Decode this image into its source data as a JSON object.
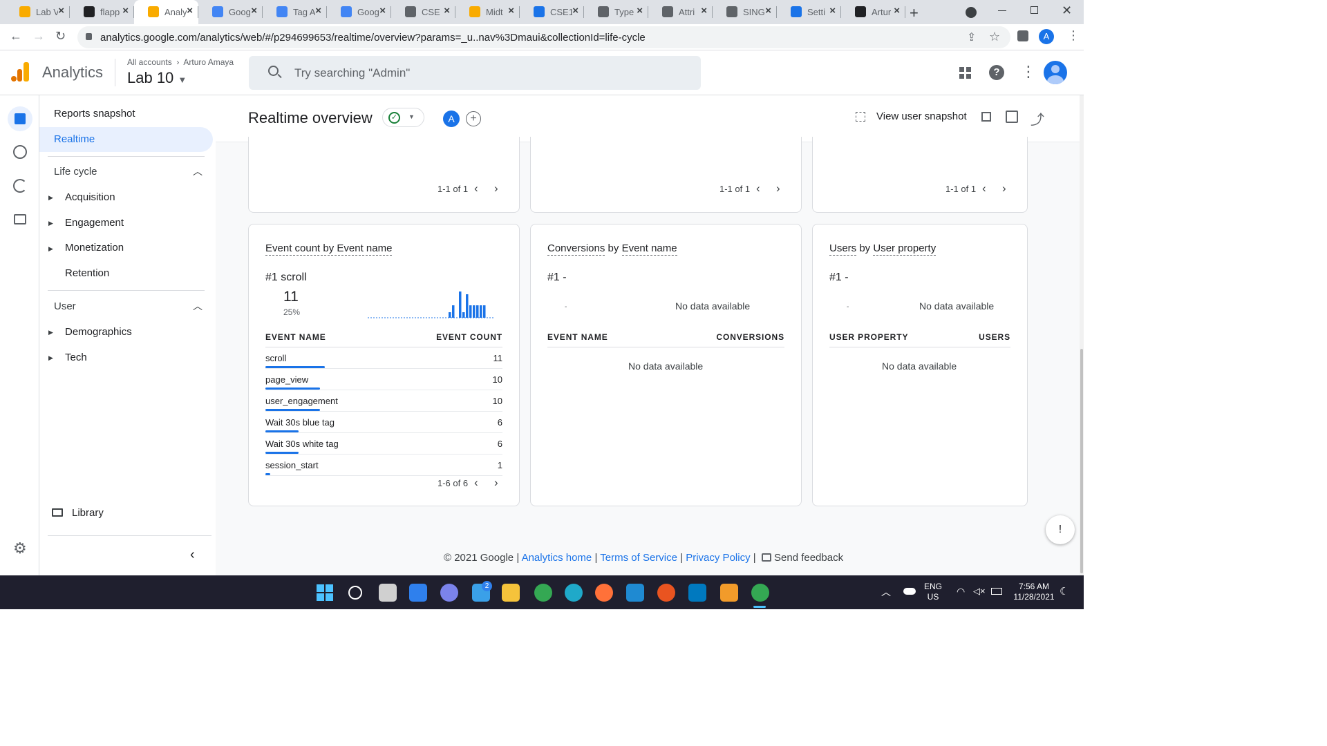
{
  "browser": {
    "tabs": [
      {
        "label": "Lab V",
        "color": "#f9ab00"
      },
      {
        "label": "flapp",
        "color": "#202124"
      },
      {
        "label": "Analy",
        "color": "#f9ab00"
      },
      {
        "label": "Goog",
        "color": "#4285f4"
      },
      {
        "label": "Tag A",
        "color": "#4285f4"
      },
      {
        "label": "Goog",
        "color": "#4285f4"
      },
      {
        "label": "CSE",
        "color": "#5f6368"
      },
      {
        "label": "Midt",
        "color": "#f9ab00"
      },
      {
        "label": "CSE1",
        "color": "#1a73e8"
      },
      {
        "label": "Type",
        "color": "#5f6368"
      },
      {
        "label": "Attri",
        "color": "#5f6368"
      },
      {
        "label": "SING",
        "color": "#5f6368"
      },
      {
        "label": "Setti",
        "color": "#1a73e8"
      },
      {
        "label": "Artur",
        "color": "#202124"
      }
    ],
    "url": "analytics.google.com/analytics/web/#/p294699653/realtime/overview?params=_u..nav%3Dmaui&collectionId=life-cycle",
    "profile_initial": "A"
  },
  "header": {
    "app_name": "Analytics",
    "breadcrumb_root": "All accounts",
    "breadcrumb_account": "Arturo Amaya",
    "property": "Lab 10",
    "search_placeholder": "Try searching \"Admin\""
  },
  "sidenav": {
    "reports_snapshot": "Reports snapshot",
    "realtime": "Realtime",
    "life_cycle": "Life cycle",
    "acquisition": "Acquisition",
    "engagement": "Engagement",
    "monetization": "Monetization",
    "retention": "Retention",
    "user": "User",
    "demographics": "Demographics",
    "tech": "Tech",
    "library": "Library"
  },
  "page": {
    "title": "Realtime overview",
    "comparison_initial": "A",
    "view_snapshot": "View user snapshot"
  },
  "top_cards": {
    "pager": [
      "1-1 of 1",
      "1-1 of 1",
      "1-1 of 1"
    ]
  },
  "cards": {
    "events": {
      "title": "Event count by Event name",
      "rank": "#1",
      "top_name": "scroll",
      "top_value": "11",
      "top_pct": "25%",
      "col_name": "EVENT NAME",
      "col_value": "EVENT COUNT",
      "rows": [
        {
          "name": "scroll",
          "value": "11",
          "share": 0.25
        },
        {
          "name": "page_view",
          "value": "10",
          "share": 0.23
        },
        {
          "name": "user_engagement",
          "value": "10",
          "share": 0.23
        },
        {
          "name": "Wait 30s blue tag",
          "value": "6",
          "share": 0.14
        },
        {
          "name": "Wait 30s white tag",
          "value": "6",
          "share": 0.14
        },
        {
          "name": "session_start",
          "value": "1",
          "share": 0.02
        }
      ],
      "pager": "1-6 of 6"
    },
    "conversions": {
      "title_a": "Conversions",
      "title_mid": "by",
      "title_b": "Event name",
      "rank": "#1",
      "top_name": "-",
      "mini_label": "-",
      "no_data_top": "No data available",
      "col_name": "EVENT NAME",
      "col_value": "CONVERSIONS",
      "no_data": "No data available"
    },
    "user_property": {
      "title_a": "Users",
      "title_mid": "by",
      "title_b": "User property",
      "rank": "#1",
      "top_name": "-",
      "mini_label": "-",
      "no_data_top": "No data available",
      "col_name": "USER PROPERTY",
      "col_value": "USERS",
      "no_data": "No data available"
    }
  },
  "footer": {
    "copyright": "© 2021 Google",
    "sep": "|",
    "analytics_home": "Analytics home",
    "terms": "Terms of Service",
    "privacy": "Privacy Policy",
    "feedback": "Send feedback"
  },
  "taskbar": {
    "lang": "ENG",
    "region": "US",
    "time": "7:56 AM",
    "date": "11/28/2021",
    "badge_count": "2"
  },
  "colors": {
    "accent": "#1a73e8",
    "nav_selected_bg": "#e8f0fe",
    "ga_orange": "#f9ab00",
    "ga_dark_orange": "#e37400",
    "success_green": "#188038"
  }
}
